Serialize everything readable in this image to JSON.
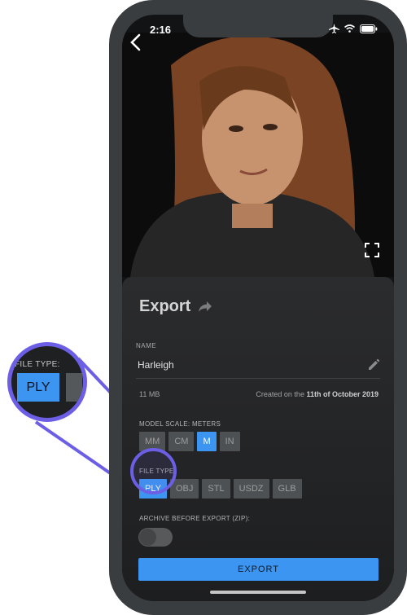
{
  "status_bar": {
    "time": "2:16",
    "icons": [
      "airplane-icon",
      "wifi-icon",
      "battery-icon"
    ]
  },
  "nav": {
    "back_icon": "chevron-left-icon",
    "expand_icon": "expand-icon"
  },
  "export_sheet": {
    "title": "Export",
    "share_icon": "share-arrow-icon",
    "name_label": "NAME",
    "name_value": "Harleigh",
    "file_size": "11 MB",
    "created_prefix": "Created on the ",
    "created_date": "11th of October 2019",
    "model_scale_label": "MODEL SCALE: METERS",
    "scale_options": [
      "MM",
      "CM",
      "M",
      "IN"
    ],
    "scale_selected": "M",
    "file_type_label": "FILE TYPE:",
    "file_type_options": [
      "PLY",
      "OBJ",
      "STL",
      "USDZ",
      "GLB"
    ],
    "file_type_selected": "PLY",
    "archive_label": "ARCHIVE BEFORE EXPORT (ZIP):",
    "archive_enabled": false,
    "export_button": "EXPORT"
  },
  "zoom_callout": {
    "label": "FILE TYPE:",
    "selected": "PLY"
  },
  "colors": {
    "accent": "#3c95f0",
    "highlight": "#6c5fe6",
    "background": "#121314"
  }
}
